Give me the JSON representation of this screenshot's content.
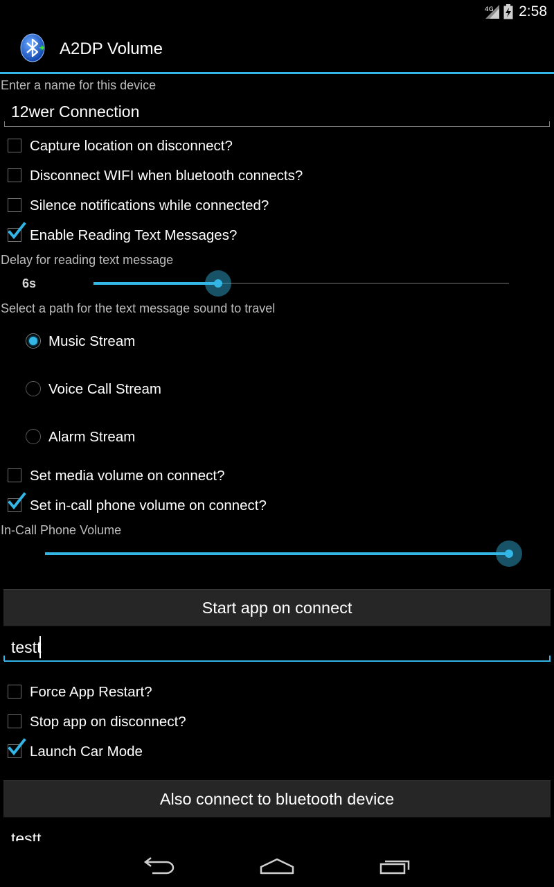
{
  "status_bar": {
    "network_type": "4G",
    "clock": "2:58",
    "icons": [
      "network-signal-icon",
      "battery-icon"
    ]
  },
  "action_bar": {
    "title": "A2DP Volume",
    "icon": "bluetooth-app-icon",
    "accent_color": "#33b5e5"
  },
  "form": {
    "device_name": {
      "hint": "Enter a name for this device",
      "value": "12wer Connection"
    },
    "checkboxes_top": [
      {
        "label": "Capture location on disconnect?",
        "checked": false
      },
      {
        "label": "Disconnect WIFI when bluetooth connects?",
        "checked": false
      },
      {
        "label": "Silence notifications while connected?",
        "checked": false
      },
      {
        "label": "Enable Reading Text Messages?",
        "checked": true
      }
    ],
    "delay": {
      "label": "Delay for reading text message",
      "value_text": "6s",
      "level": 0.3
    },
    "stream": {
      "label": "Select a path for the text message sound to travel",
      "options": [
        {
          "label": "Music Stream",
          "selected": true
        },
        {
          "label": "Voice Call Stream",
          "selected": false
        },
        {
          "label": "Alarm Stream",
          "selected": false
        }
      ]
    },
    "checkboxes_volume": [
      {
        "label": "Set media volume on connect?",
        "checked": false
      },
      {
        "label": "Set in-call phone volume on connect?",
        "checked": true
      }
    ],
    "incall_volume": {
      "label": "In-Call Phone Volume",
      "level": 1.0
    },
    "start_app_button": "Start app on connect",
    "app_field_value": "testt",
    "checkboxes_app": [
      {
        "label": "Force App Restart?",
        "checked": false
      },
      {
        "label": "Stop app on disconnect?",
        "checked": false
      },
      {
        "label": "Launch Car Mode",
        "checked": true
      }
    ],
    "bluetooth_button": "Also connect to bluetooth device",
    "bluetooth_field_value": "testt"
  },
  "nav_bar": {
    "icons": [
      "back-icon",
      "home-icon",
      "recent-apps-icon"
    ]
  }
}
